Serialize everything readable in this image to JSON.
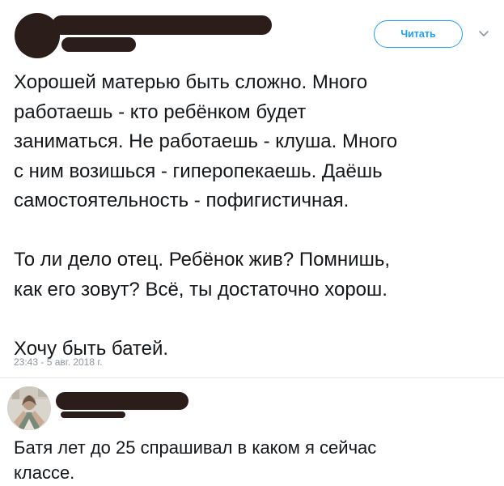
{
  "tweet": {
    "follow_label": "Читать",
    "text": "Хорошей матерью быть сложно. Много\nработаешь - кто ребёнком будет\nзаниматься. Не работаешь - клуша. Много\nс ним возишься - гиперопекаешь. Даёшь\nсамостоятельность - пофигистичная.\n\nТо ли дело отец. Ребёнок жив? Помнишь,\nкак его зовут? Всё, ты достаточно хорош.\n\nХочу быть батей.",
    "timestamp": "23:43 - 5 авг. 2018 г.",
    "icons": {
      "menu": "chevron-down-icon"
    }
  },
  "reply": {
    "text": "Батя лет до 25 спрашивал в каком я сейчас\nклассе."
  },
  "colors": {
    "accent": "#1da1f2",
    "redaction": "#2b1d1a",
    "text": "#14171a",
    "muted": "#8a959e",
    "divider": "#e3e7ea"
  }
}
